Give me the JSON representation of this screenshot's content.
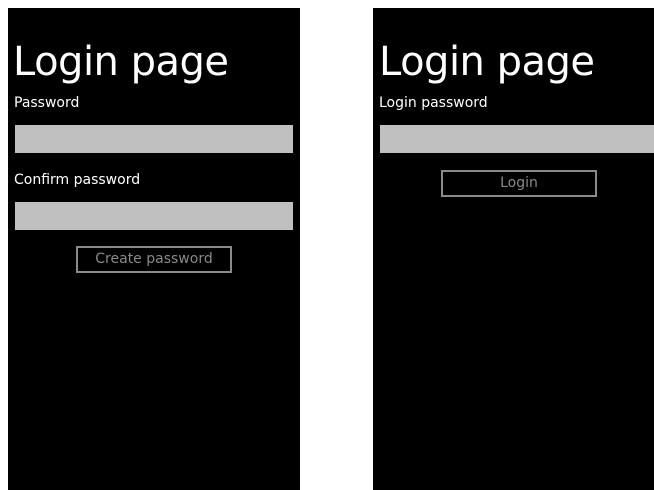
{
  "create_screen": {
    "title": "Login page",
    "password_label": "Password",
    "password_value": "",
    "confirm_label": "Confirm password",
    "confirm_value": "",
    "create_button": "Create password"
  },
  "login_screen": {
    "title": "Login page",
    "password_label": "Login password",
    "password_value": "",
    "login_button": "Login"
  },
  "colors": {
    "background": "#000000",
    "text": "#ffffff",
    "field": "#c0c0c0",
    "button_border": "#8a8a8a"
  }
}
